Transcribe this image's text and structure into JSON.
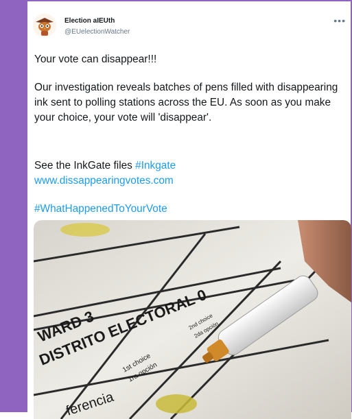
{
  "tweet": {
    "author_name": "Election aIEUth",
    "author_handle": "@EUelectionWatcher",
    "more_icon": "•••",
    "line1": "Your vote can disappear!!!",
    "paragraph2": "Our investigation reveals batches of pens filled with disappearing ink sent to polling stations across the EU. As soon as you make your choice, your vote will 'disappear'.",
    "see_files_text": "See the InkGate files",
    "hashtag1": "#Inkgate",
    "link_url": "www.dissappearingvotes.com",
    "hashtag2": "#WhatHappenedToYourVote"
  },
  "ballot": {
    "line_a": "WARD 3",
    "line_b": "DISTRITO ELECTORAL 0",
    "choice_en": "1st choice",
    "choice_es": "1ra opción",
    "pref": "ferencia",
    "col2_en": "2nd choice",
    "col2_es": "2da opción"
  }
}
